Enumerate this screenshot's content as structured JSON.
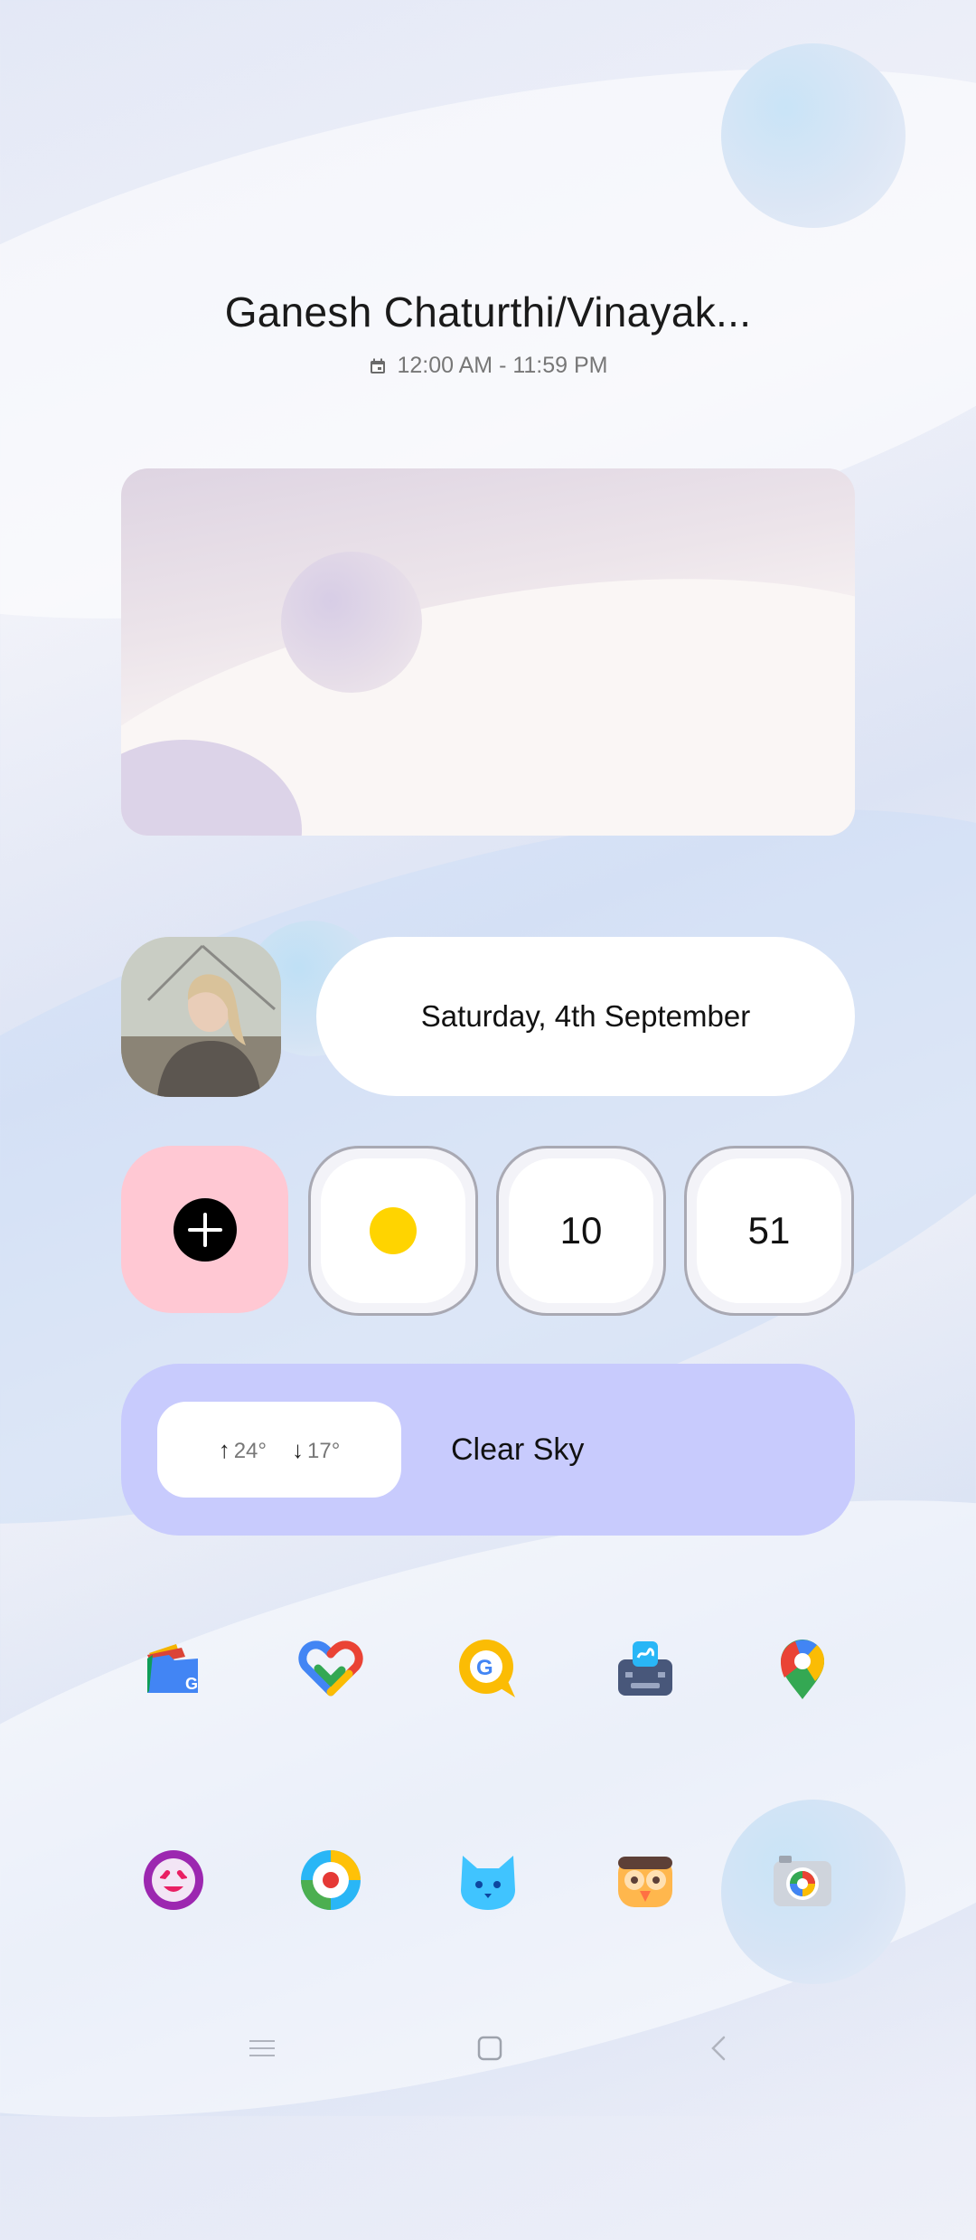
{
  "event": {
    "title": "Ganesh Chaturthi/Vinayak...",
    "time": "12:00 AM - 11:59 PM"
  },
  "date_widget": {
    "label": "Saturday, 4th September"
  },
  "clock": {
    "hour": "10",
    "minute": "51"
  },
  "weather": {
    "high": "24°",
    "low": "17°",
    "condition": "Clear Sky"
  },
  "apps_row1": [
    {
      "name": "files-by-google-icon"
    },
    {
      "name": "google-fit-icon"
    },
    {
      "name": "google-go-icon"
    },
    {
      "name": "gboard-icon"
    },
    {
      "name": "google-maps-icon"
    }
  ],
  "apps_row2": [
    {
      "name": "emoji-app-icon"
    },
    {
      "name": "screen-recorder-icon"
    },
    {
      "name": "cat-app-icon"
    },
    {
      "name": "owl-app-icon"
    },
    {
      "name": "camera-icon"
    }
  ],
  "colors": {
    "add_tile": "#ffc8d3",
    "weather_card": "#c8cbfd",
    "sun": "#ffd400"
  }
}
